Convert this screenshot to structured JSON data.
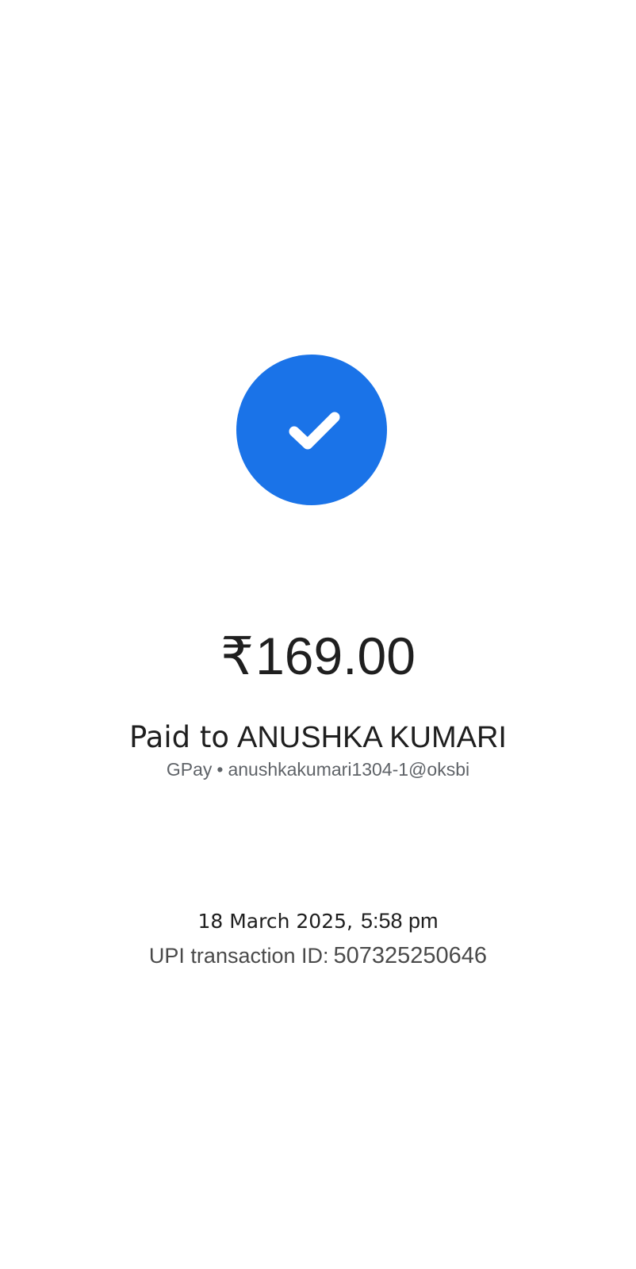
{
  "status": {
    "icon": "check-icon",
    "accent_color": "#1a73e8"
  },
  "payment": {
    "currency_symbol": "₹",
    "amount": "169.00",
    "paid_to_label": "Paid to",
    "payee_name": "ANUSHKA KUMARI",
    "app_name": "GPay",
    "separator": "•",
    "upi_id": "anushkakumari1304-1@oksbi"
  },
  "transaction": {
    "date": "18 March 2025,",
    "time": "5:58 pm",
    "id_label": "UPI transaction ID:",
    "id_value": "507325250646"
  }
}
